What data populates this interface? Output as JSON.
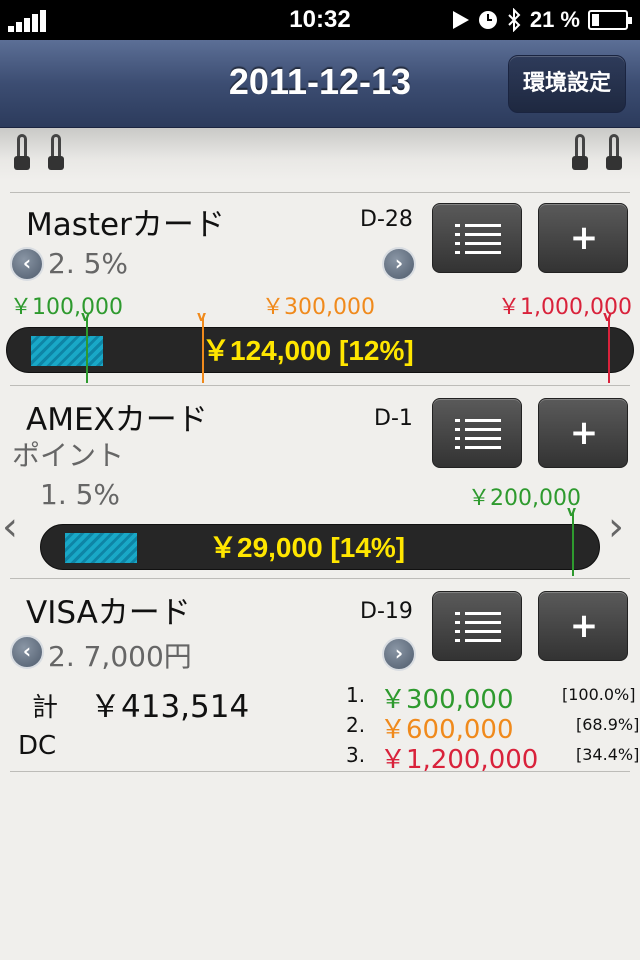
{
  "status_bar": {
    "time": "10:32",
    "battery_percent": "21 %",
    "battery_level": 0.21,
    "icons": [
      "signal-bars-icon",
      "play-icon",
      "alarm-clock-icon",
      "bluetooth-icon",
      "battery-icon"
    ]
  },
  "nav": {
    "title": "2011-12-13",
    "settings_label": "環境設定"
  },
  "colors": {
    "nav_blue": "#3c4d72",
    "green": "#2e9a2e",
    "orange": "#f08a1c",
    "red": "#d9223b",
    "bar_yellow": "#ffe600",
    "fill_cyan": "#19a8c7"
  },
  "cards": [
    {
      "name": "Masterカード",
      "code": "D-28",
      "rate": "2. 5%",
      "limits": [
        "￥100,000",
        "￥300,000",
        "￥1,000,000"
      ],
      "limit_values": [
        100000,
        300000,
        1000000
      ],
      "bar_label": "￥124,000 [12%]",
      "amount": 124000,
      "fill_fraction": 0.12
    },
    {
      "name": "AMEXカード",
      "code": "D-1",
      "subtitle": "ポイント",
      "rate": "1. 5%",
      "limits": [
        "￥200,000"
      ],
      "limit_values": [
        200000
      ],
      "bar_label": "￥29,000 [14%]",
      "amount": 29000,
      "fill_fraction": 0.14
    },
    {
      "name": "VISAカード",
      "code": "D-19",
      "rate": "2. 7,000円"
    }
  ],
  "summary": {
    "total_label": "計",
    "total_value": "￥413,514",
    "dc_label": "DC",
    "plans": [
      {
        "num": "1.",
        "amount": "￥300,000",
        "pct": "[100.0%]"
      },
      {
        "num": "2.",
        "amount": "￥600,000",
        "pct": "[68.9%]"
      },
      {
        "num": "3.",
        "amount": "￥1,200,000",
        "pct": "[34.4%]"
      }
    ]
  }
}
